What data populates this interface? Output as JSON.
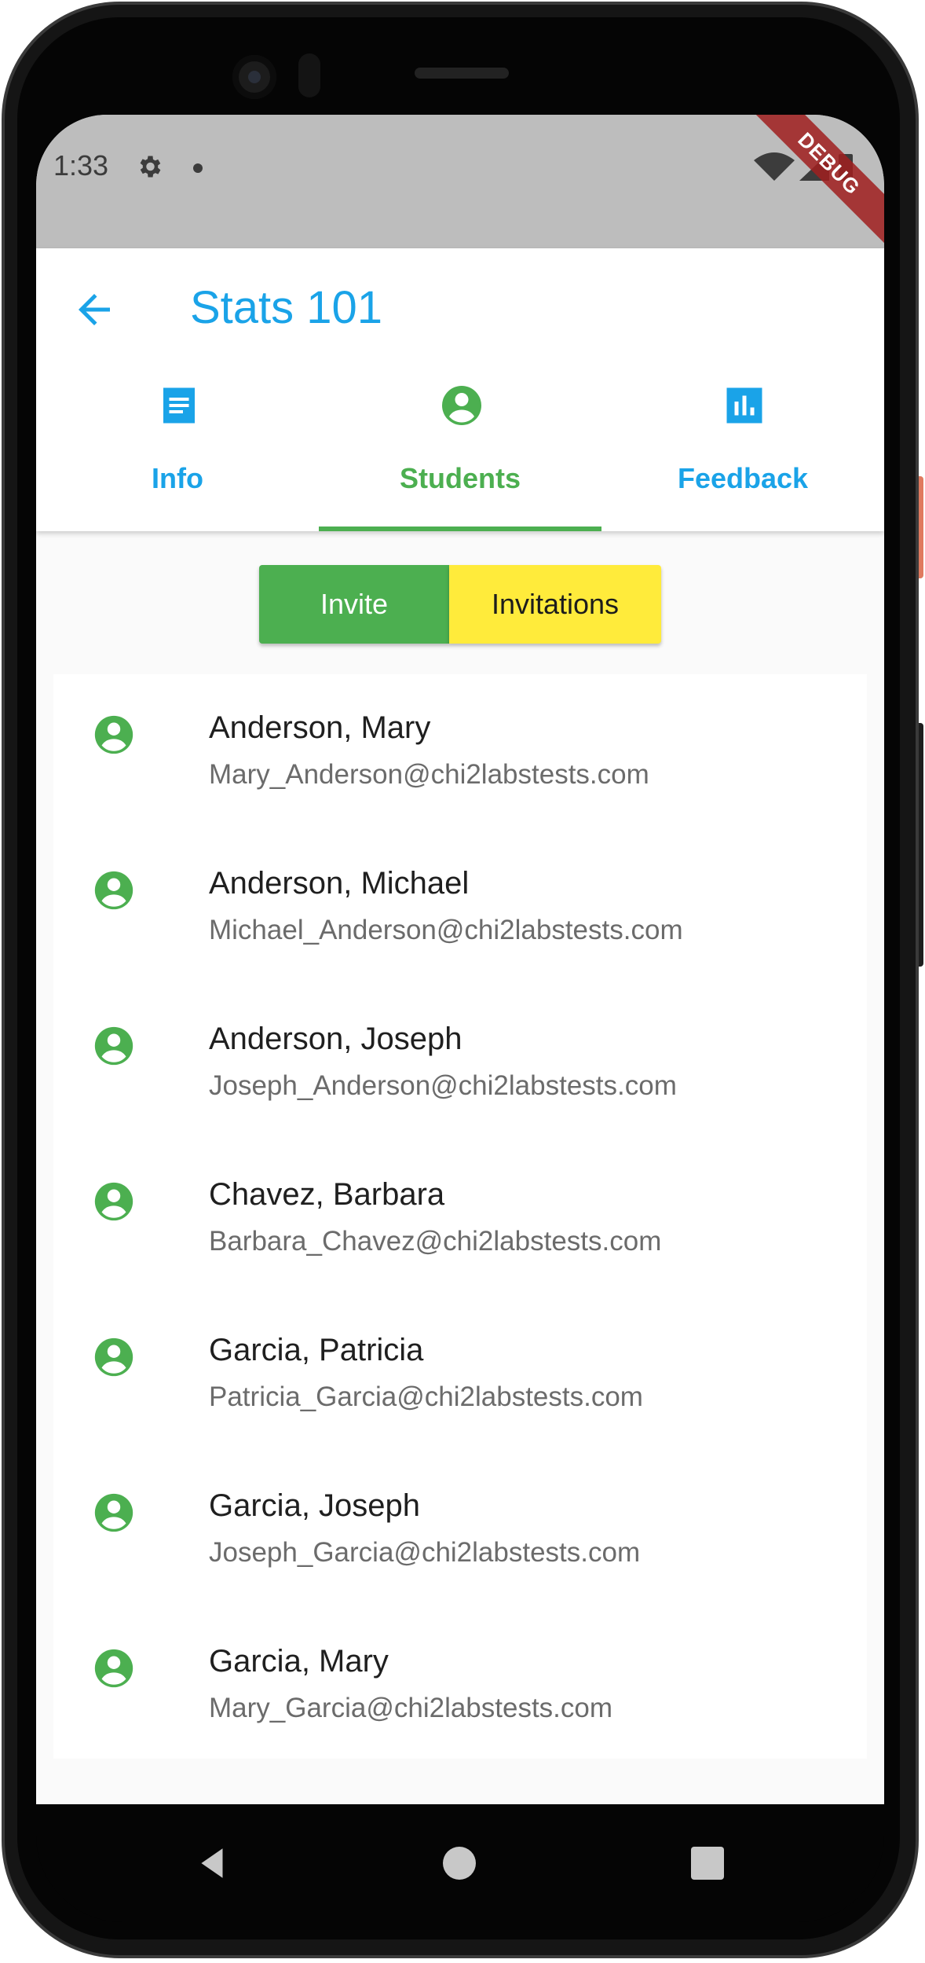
{
  "status_bar": {
    "time": "1:33",
    "icons": [
      "settings-icon",
      "notification-dot-icon",
      "wifi-icon",
      "signal-icon",
      "battery-icon"
    ],
    "debug_banner": "DEBUG",
    "debug_color": "#a01e1e"
  },
  "app_bar": {
    "title": "Stats 101",
    "back_icon": "arrow-back-icon",
    "accent_color": "#1aa3e8"
  },
  "tabs": [
    {
      "label": "Info",
      "icon": "article-icon",
      "selected": false,
      "color": "#1aa3e8"
    },
    {
      "label": "Students",
      "icon": "account-circle-icon",
      "selected": true,
      "color": "#4caf50"
    },
    {
      "label": "Feedback",
      "icon": "bar-chart-icon",
      "selected": false,
      "color": "#1aa3e8"
    }
  ],
  "actions": {
    "invite_label": "Invite",
    "invite_color": "#4caf50",
    "invitations_label": "Invitations",
    "invitations_color": "#ffeb3b"
  },
  "students": [
    {
      "name": "Anderson, Mary",
      "email": "Mary_Anderson@chi2labstests.com"
    },
    {
      "name": "Anderson, Michael",
      "email": "Michael_Anderson@chi2labstests.com"
    },
    {
      "name": "Anderson, Joseph",
      "email": "Joseph_Anderson@chi2labstests.com"
    },
    {
      "name": "Chavez, Barbara",
      "email": "Barbara_Chavez@chi2labstests.com"
    },
    {
      "name": "Garcia, Patricia",
      "email": "Patricia_Garcia@chi2labstests.com"
    },
    {
      "name": "Garcia, Joseph",
      "email": "Joseph_Garcia@chi2labstests.com"
    },
    {
      "name": "Garcia, Mary",
      "email": "Mary_Garcia@chi2labstests.com"
    }
  ],
  "student_icon": "account-circle-icon",
  "student_icon_color": "#4caf50",
  "nav_bar": {
    "icons": [
      "nav-back-icon",
      "nav-home-icon",
      "nav-recents-icon"
    ]
  }
}
